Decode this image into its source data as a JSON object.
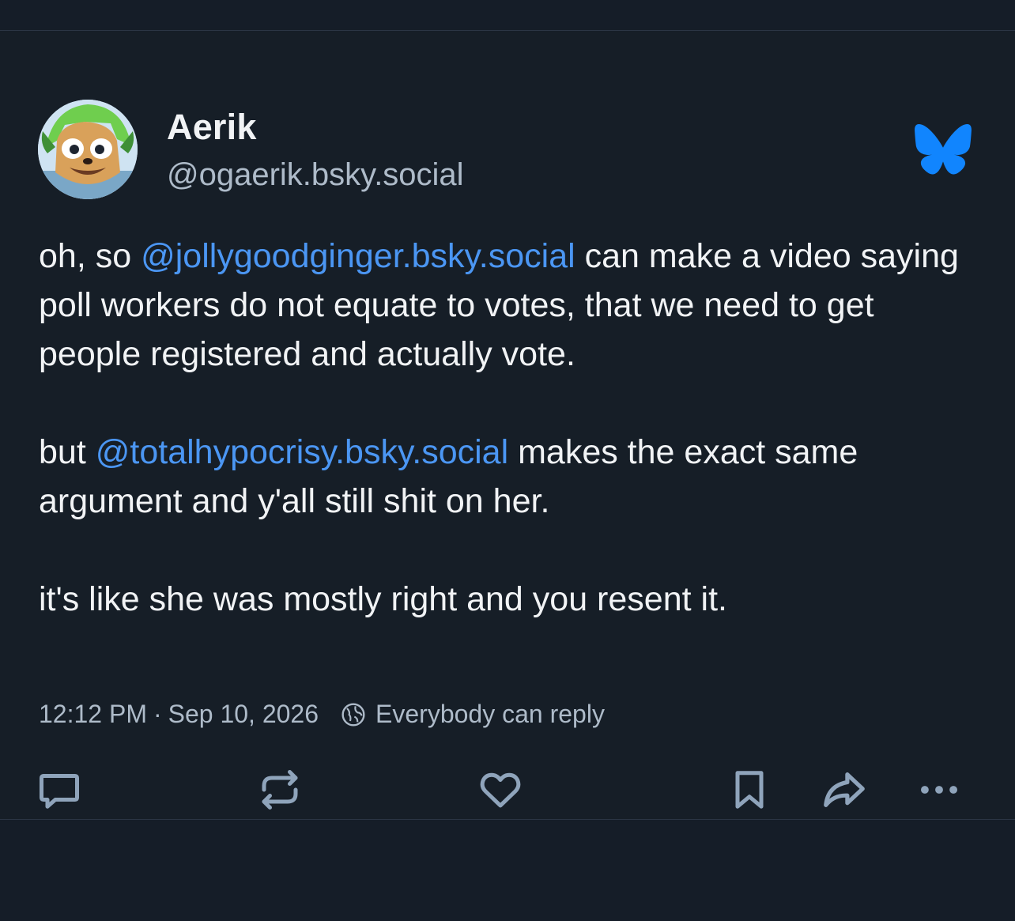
{
  "post": {
    "author": {
      "display_name": "Aerik",
      "handle": "@ogaerik.bsky.social",
      "avatar_icon": "avatar-image"
    },
    "body": {
      "paragraph1": {
        "before": "oh, so ",
        "mention": "@jollygoodginger.bsky.social",
        "after": " can make a video saying poll workers do not equate to votes, that we need to get people registered and actually vote."
      },
      "paragraph2": {
        "before": "but ",
        "mention": "@totalhypocrisy.bsky.social",
        "after": " makes the exact same argument and y'all still shit on her."
      },
      "paragraph3": "it's like she was mostly right and you resent it."
    },
    "timestamp": "12:12 PM",
    "separator": "·",
    "date": "Sep 10, 2026",
    "reply_setting": "Everybody can reply"
  },
  "actions": [
    {
      "name": "reply",
      "icon": "comment-icon"
    },
    {
      "name": "repost",
      "icon": "repost-icon"
    },
    {
      "name": "like",
      "icon": "heart-icon"
    },
    {
      "name": "bookmark",
      "icon": "bookmark-icon"
    },
    {
      "name": "share",
      "icon": "share-icon"
    },
    {
      "name": "more",
      "icon": "more-icon"
    }
  ],
  "colors": {
    "background": "#161e27",
    "text": "#f1f3f5",
    "muted": "#aebbc9",
    "mention": "#4b96f3",
    "bluesky_logo": "#1185fe",
    "icon": "#8fa4bb"
  }
}
